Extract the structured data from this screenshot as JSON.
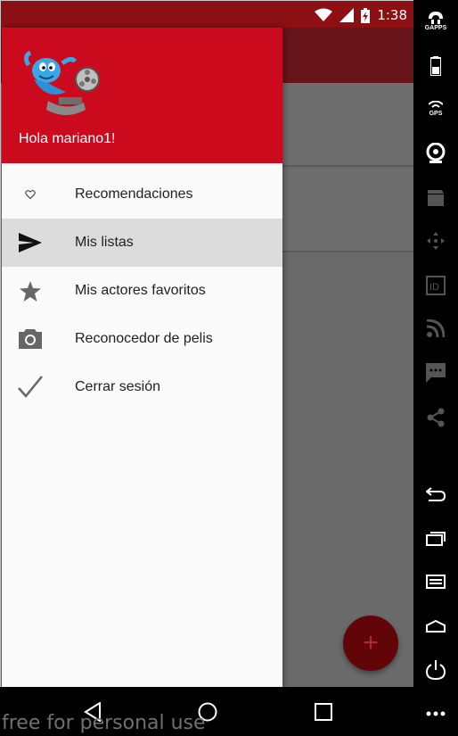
{
  "status_bar": {
    "time": "1:38",
    "icons": [
      "wifi-icon",
      "signal-icon",
      "battery-charging-icon"
    ]
  },
  "drawer": {
    "greeting": "Hola mariano1!",
    "logo": "genie-film-reel-logo",
    "header_color": "#cc0a1e",
    "menu": [
      {
        "label": "Recomendaciones",
        "icon": "heart-outline-icon",
        "active": false
      },
      {
        "label": "Mis listas",
        "icon": "send-icon",
        "active": true
      },
      {
        "label": "Mis actores favoritos",
        "icon": "star-icon",
        "active": false
      },
      {
        "label": "Reconocedor de pelis",
        "icon": "camera-icon",
        "active": false
      },
      {
        "label": "Cerrar sesión",
        "icon": "check-icon",
        "active": false
      }
    ]
  },
  "fab": {
    "icon": "plus-icon",
    "label": "+",
    "color": "#620508"
  },
  "side_strip": {
    "gapps_label": "GAPPS",
    "gps_label": "GPS",
    "id_label": "ID",
    "buttons": [
      "gapps-icon",
      "battery-icon",
      "gps-icon",
      "webcam-icon",
      "clapperboard-icon",
      "dpad-icon",
      "id-icon",
      "rss-icon",
      "message-icon",
      "share-icon",
      "back-icon",
      "recents-icon",
      "menu-icon",
      "home-icon",
      "power-icon",
      "more-icon"
    ]
  },
  "nav_bar": {
    "buttons": [
      "back-triangle-icon",
      "home-circle-icon",
      "recents-square-icon"
    ]
  },
  "watermark": "free for personal use"
}
